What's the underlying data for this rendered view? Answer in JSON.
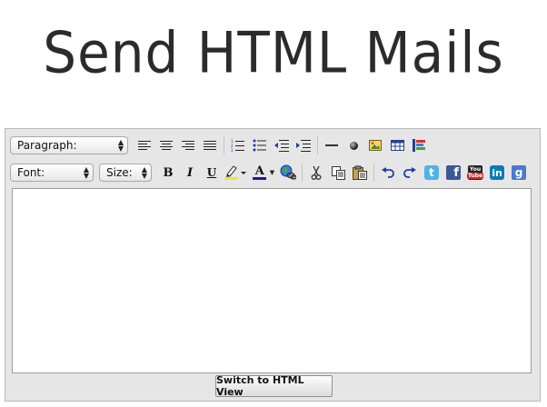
{
  "header": {
    "title": "Send HTML Mails"
  },
  "toolbar1": {
    "format_select": "Paragraph:",
    "items": [
      "align-left-icon",
      "align-center-icon",
      "align-right-icon",
      "align-justify-icon",
      "ordered-list-icon",
      "unordered-list-icon",
      "outdent-icon",
      "indent-icon",
      "horizontal-rule-icon",
      "bullet-icon",
      "insert-image-icon",
      "insert-table-icon",
      "color-bars-icon"
    ]
  },
  "toolbar2": {
    "font_select": "Font:",
    "size_select": "Size:",
    "bold": "B",
    "italic": "I",
    "underline": "U",
    "text_color_letter": "A",
    "twitter": "t",
    "facebook": "f",
    "youtube_top": "You",
    "youtube_bottom": "Tube",
    "linkedin": "in",
    "google": "g"
  },
  "footer": {
    "switch_label": "Switch to HTML View"
  },
  "colors": {
    "highlight": "#f5e23a",
    "text_color": "#1a1aa0",
    "twitter": "#4fb3e8",
    "facebook": "#3b5998",
    "youtube": "#c4302b",
    "linkedin": "#0a7bb6",
    "google": "#4a7ad0"
  }
}
